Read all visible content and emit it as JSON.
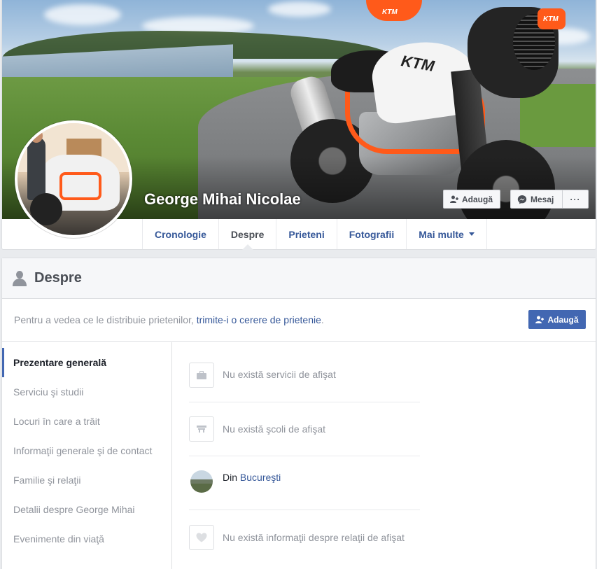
{
  "profile": {
    "name": "George Mihai Nicolae",
    "cover_logos": {
      "tank": "KTM",
      "handguard_left": "KTM",
      "handguard_right": "KTM"
    }
  },
  "cover_buttons": {
    "add_label": "Adaugă",
    "message_label": "Mesaj",
    "more_label": "···"
  },
  "tabs": [
    {
      "label": "Cronologie"
    },
    {
      "label": "Despre"
    },
    {
      "label": "Prieteni"
    },
    {
      "label": "Fotografii"
    },
    {
      "label": "Mai multe"
    }
  ],
  "about": {
    "title": "Despre",
    "notice_prefix": "Pentru a vedea ce le distribuie prietenilor, ",
    "notice_link": "trimite-i o cerere de prietenie",
    "notice_suffix": ".",
    "add_label": "Adaugă",
    "nav": [
      {
        "label": "Prezentare generală"
      },
      {
        "label": "Serviciu şi studii"
      },
      {
        "label": "Locuri în care a trăit"
      },
      {
        "label": "Informaţii generale şi de contact"
      },
      {
        "label": "Familie şi relaţii"
      },
      {
        "label": "Detalii despre George Mihai"
      },
      {
        "label": "Evenimente din viaţă"
      }
    ],
    "overview": {
      "work": "Nu există servicii de afişat",
      "school": "Nu există şcoli de afişat",
      "from_prefix": "Din ",
      "from_city": "Bucureşti",
      "relationship": "Nu există informaţii despre relaţii de afişat"
    }
  },
  "colors": {
    "link": "#365899",
    "primary_button": "#4267b2",
    "accent_orange": "#ff5a1a",
    "muted_text": "#90949c"
  }
}
